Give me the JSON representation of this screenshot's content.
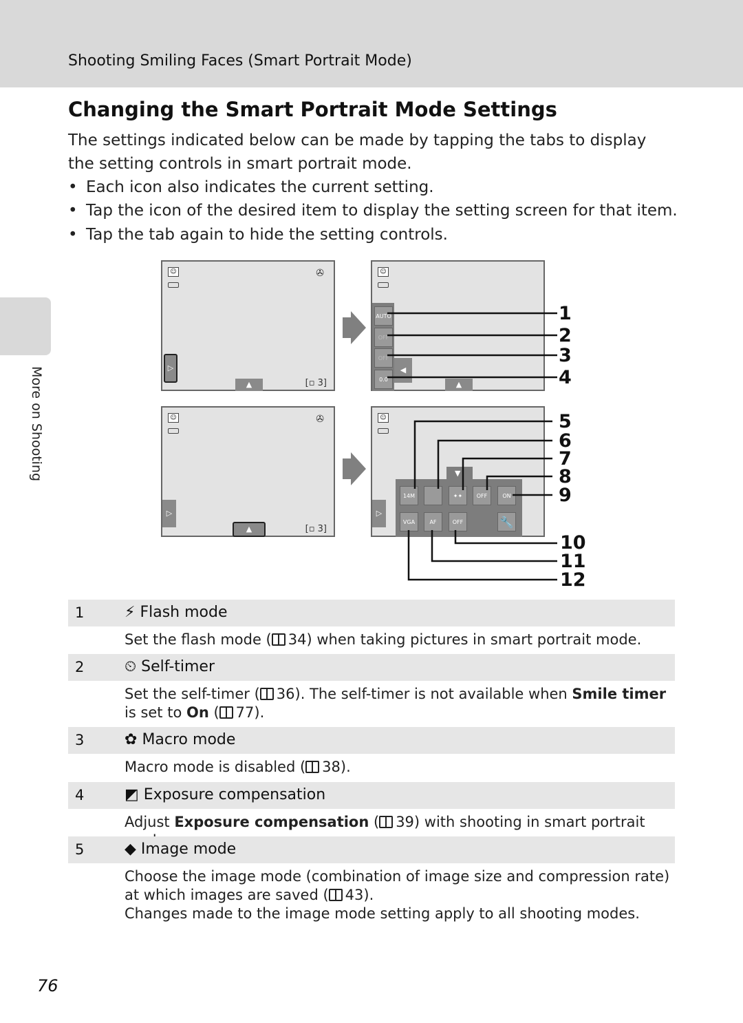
{
  "header": {
    "running_title": "Shooting Smiling Faces (Smart Portrait Mode)"
  },
  "title": "Changing the Smart Portrait Mode Settings",
  "intro": "The settings indicated below can be made by tapping the tabs to display the setting controls in smart portrait mode.",
  "bullets": [
    "Each icon also indicates the current setting.",
    "Tap the icon of the desired item to display the setting screen for that item.",
    "Tap the tab again to hide the setting controls."
  ],
  "side_tab": "More on Shooting",
  "diagram": {
    "shots_remaining": "3",
    "left_panel_icons": [
      "AUTO",
      "OFF",
      "OFF",
      "0.0"
    ],
    "bottom_panel_icons": [
      "14M",
      "",
      "",
      "OFF",
      "ON",
      "VGA",
      "AF",
      "OFF"
    ],
    "callouts": [
      "1",
      "2",
      "3",
      "4",
      "5",
      "6",
      "7",
      "8",
      "9",
      "10",
      "11",
      "12"
    ]
  },
  "items": [
    {
      "num": "1",
      "icon": "flash-icon",
      "label": "Flash mode",
      "desc": [
        {
          "t": "Set the flash mode ("
        },
        {
          "ref": "34"
        },
        {
          "t": ") when taking pictures in smart portrait mode."
        }
      ]
    },
    {
      "num": "2",
      "icon": "self-timer-icon",
      "label": "Self-timer",
      "desc": [
        {
          "t": "Set the self-timer ("
        },
        {
          "ref": "36"
        },
        {
          "t": "). The self-timer is not available when "
        },
        {
          "b": "Smile timer"
        },
        {
          "t": " is set to "
        },
        {
          "b": "On"
        },
        {
          "t": " ("
        },
        {
          "ref": "77"
        },
        {
          "t": ")."
        }
      ]
    },
    {
      "num": "3",
      "icon": "macro-icon",
      "label": "Macro mode",
      "desc": [
        {
          "t": "Macro mode is disabled ("
        },
        {
          "ref": "38"
        },
        {
          "t": ")."
        }
      ]
    },
    {
      "num": "4",
      "icon": "exposure-compensation-icon",
      "label": "Exposure compensation",
      "desc": [
        {
          "t": "Adjust "
        },
        {
          "b": "Exposure compensation"
        },
        {
          "t": " ("
        },
        {
          "ref": "39"
        },
        {
          "t": ") with shooting in smart portrait mode."
        }
      ]
    },
    {
      "num": "5",
      "icon": "image-mode-icon",
      "label": "Image mode",
      "desc": [
        {
          "t": "Choose the image mode (combination of image size and compression rate) at which images are saved ("
        },
        {
          "ref": "43"
        },
        {
          "t": ")."
        },
        {
          "br": true
        },
        {
          "t": "Changes made to the image mode setting apply to all shooting modes."
        }
      ]
    }
  ],
  "page_number": "76"
}
